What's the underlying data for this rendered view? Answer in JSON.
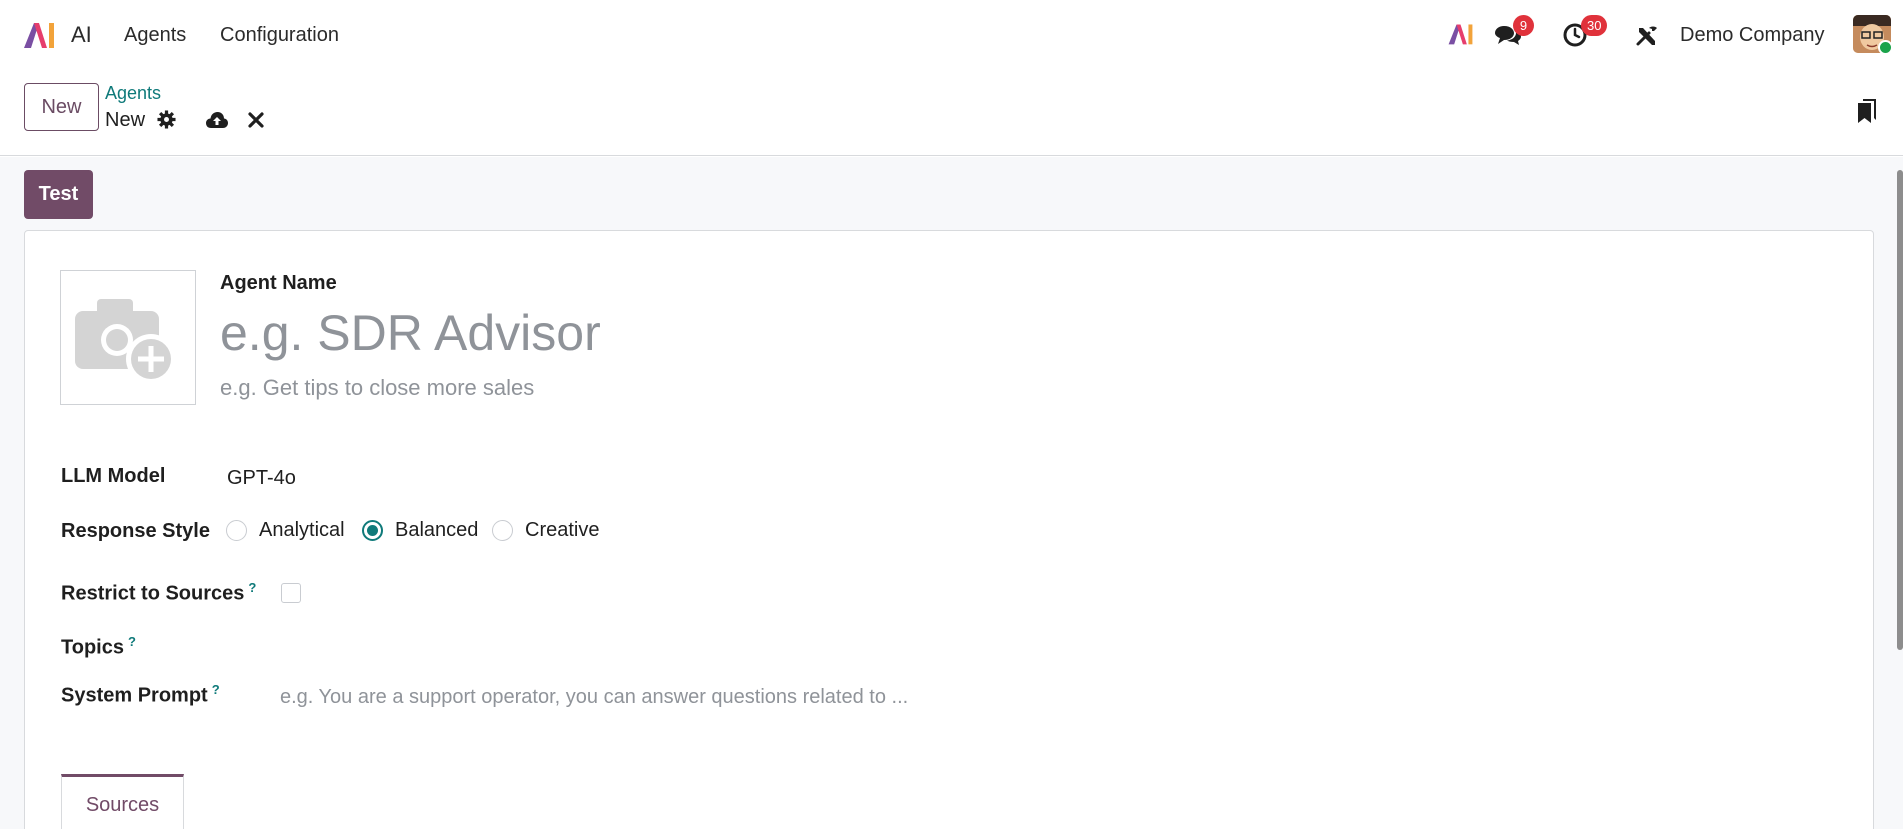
{
  "navbar": {
    "app_name": "AI",
    "menu": [
      "Agents",
      "Configuration"
    ],
    "chat_count": "9",
    "activity_count": "30",
    "company": "Demo Company",
    "brand_colors": [
      "#e63e6d",
      "#f2a33a",
      "#7a4fa3"
    ]
  },
  "control_panel": {
    "new_button": "New",
    "breadcrumb_parent": "Agents",
    "breadcrumb_current": "New"
  },
  "form": {
    "test_button": "Test",
    "agent_name_label": "Agent Name",
    "agent_name_placeholder": "e.g. SDR Advisor",
    "subtitle_placeholder": "e.g. Get tips to close more sales",
    "llm_label": "LLM Model",
    "llm_value": "GPT-4o",
    "style_label": "Response Style",
    "style_options": [
      "Analytical",
      "Balanced",
      "Creative"
    ],
    "style_selected": "Balanced",
    "restrict_label": "Restrict to Sources",
    "restrict_checked": false,
    "topics_label": "Topics",
    "prompt_label": "System Prompt",
    "prompt_placeholder": "e.g. You are a support operator, you can answer questions related to ...",
    "help_mark": "?"
  },
  "tabs": {
    "sources": "Sources"
  },
  "colors": {
    "primary": "#714b67",
    "accent": "#0f7a7a",
    "badge": "#e0323b"
  }
}
